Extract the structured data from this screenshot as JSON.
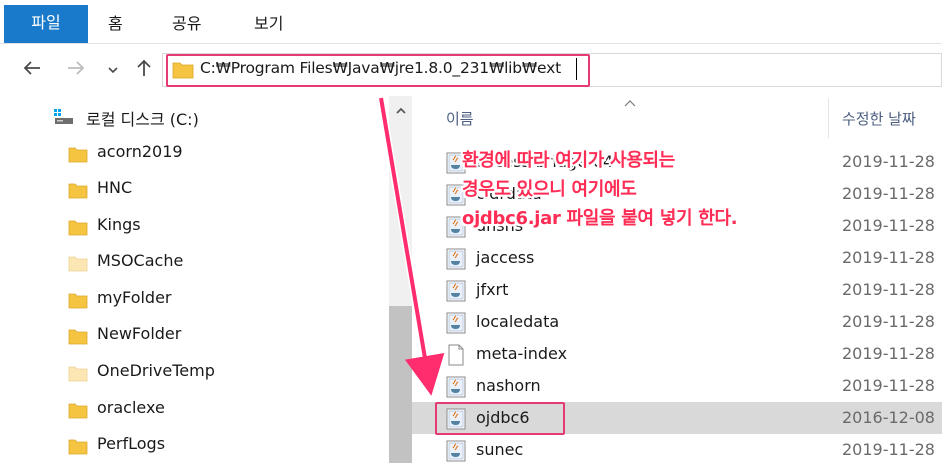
{
  "ribbon": {
    "tabs": [
      {
        "label": "파일",
        "active": true
      },
      {
        "label": "홈"
      },
      {
        "label": "공유"
      },
      {
        "label": "보기"
      }
    ]
  },
  "address": {
    "path": "C:₩Program Files₩Java₩jre1.8.0_231₩lib₩ext"
  },
  "nav_pane": {
    "drive_label": "로컬 디스크 (C:)",
    "folders": [
      {
        "label": "acorn2019"
      },
      {
        "label": "HNC"
      },
      {
        "label": "Kings"
      },
      {
        "label": "MSOCache"
      },
      {
        "label": "myFolder"
      },
      {
        "label": "NewFolder"
      },
      {
        "label": "OneDriveTemp"
      },
      {
        "label": "oraclexe"
      },
      {
        "label": "PerfLogs"
      }
    ]
  },
  "file_list": {
    "col_name": "이름",
    "col_date": "수정한 날짜",
    "files": [
      {
        "name": "access-bridge-64",
        "date": "2019-11-28",
        "type": "jar"
      },
      {
        "name": "cldrdata",
        "date": "2019-11-28",
        "type": "jar"
      },
      {
        "name": "dnsns",
        "date": "2019-11-28",
        "type": "jar"
      },
      {
        "name": "jaccess",
        "date": "2019-11-28",
        "type": "jar"
      },
      {
        "name": "jfxrt",
        "date": "2019-11-28",
        "type": "jar"
      },
      {
        "name": "localedata",
        "date": "2019-11-28",
        "type": "jar"
      },
      {
        "name": "meta-index",
        "date": "2019-11-28",
        "type": "file"
      },
      {
        "name": "nashorn",
        "date": "2019-11-28",
        "type": "jar"
      },
      {
        "name": "ojdbc6",
        "date": "2016-12-08",
        "type": "jar",
        "selected": true
      },
      {
        "name": "sunec",
        "date": "2019-11-28",
        "type": "jar"
      }
    ]
  },
  "annotation": {
    "lines": [
      "환경에 따라 여기가 사용되는",
      "경우도 있으니 여기에도",
      "ojdbc6.jar 파일을 붙여 넣기 한다."
    ]
  },
  "colors": {
    "accent": "#1979ca",
    "highlight": "#e53a76",
    "annotation": "#ff2d55",
    "folder": "#f5c542"
  }
}
